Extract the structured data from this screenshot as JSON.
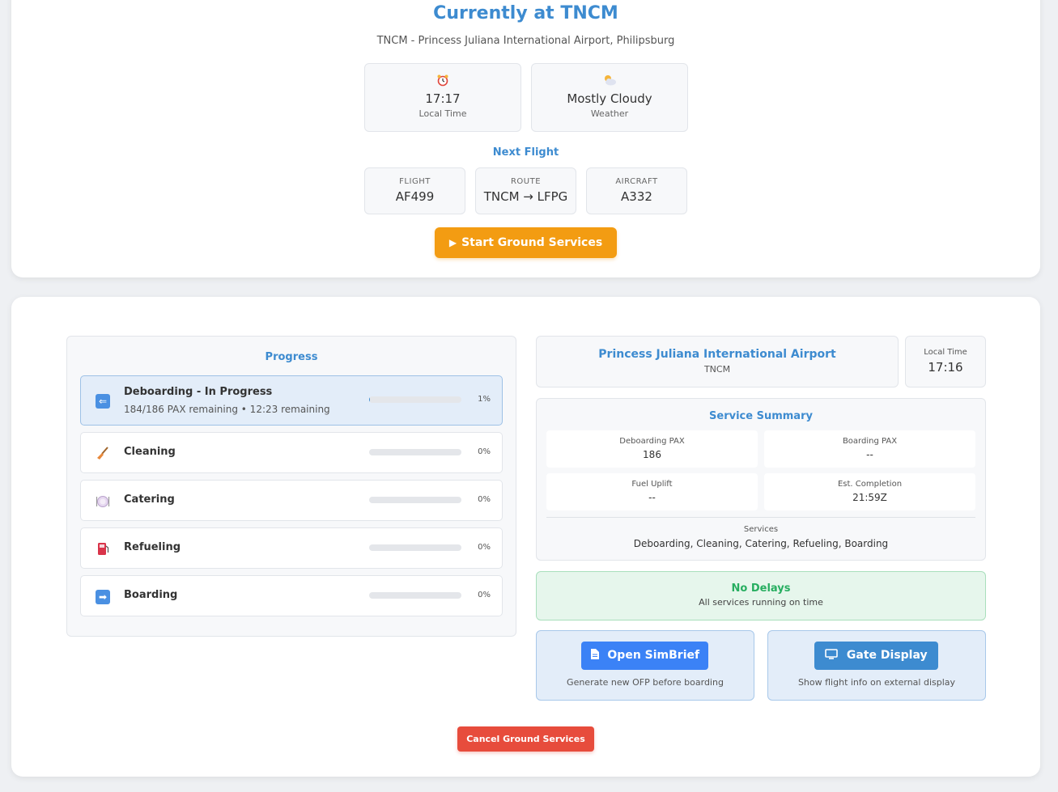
{
  "header": {
    "title": "Currently at TNCM",
    "airport_line": "TNCM - Princess Juliana International Airport, Philipsburg",
    "local_time": {
      "icon": "alarm-clock-icon",
      "value": "17:17",
      "label": "Local Time"
    },
    "weather": {
      "icon": "cloud-sun-icon",
      "value": "Mostly Cloudy",
      "label": "Weather"
    }
  },
  "next_flight": {
    "title": "Next Flight",
    "flight": {
      "label": "FLIGHT",
      "value": "AF499"
    },
    "route": {
      "label": "ROUTE",
      "value": "TNCM → LFPG"
    },
    "aircraft": {
      "label": "AIRCRAFT",
      "value": "A332"
    },
    "start_button": "Start Ground Services"
  },
  "progress": {
    "title": "Progress",
    "items": [
      {
        "name": "Deboarding - In Progress",
        "detail": "184/186 PAX remaining • 12:23 remaining",
        "progress": 0.01,
        "percent": "1%",
        "icon": "arrow-left-icon",
        "active": true
      },
      {
        "name": "Cleaning",
        "progress": 0,
        "percent": "0%",
        "icon": "broom-icon"
      },
      {
        "name": "Catering",
        "progress": 0,
        "percent": "0%",
        "icon": "plate-icon"
      },
      {
        "name": "Refueling",
        "progress": 0,
        "percent": "0%",
        "icon": "fuel-pump-icon"
      },
      {
        "name": "Boarding",
        "progress": 0,
        "percent": "0%",
        "icon": "arrow-right-icon"
      }
    ]
  },
  "airport_panel": {
    "name": "Princess Juliana International Airport",
    "code": "TNCM",
    "time_label": "Local Time",
    "time_value": "17:16"
  },
  "summary": {
    "title": "Service Summary",
    "deboarding_pax": {
      "label": "Deboarding PAX",
      "value": "186"
    },
    "boarding_pax": {
      "label": "Boarding PAX",
      "value": "--"
    },
    "fuel_uplift": {
      "label": "Fuel Uplift",
      "value": "--"
    },
    "est_completion": {
      "label": "Est. Completion",
      "value": "21:59Z"
    },
    "services_label": "Services",
    "services_value": "Deboarding, Cleaning, Catering, Refueling, Boarding"
  },
  "delays": {
    "title": "No Delays",
    "subtitle": "All services running on time",
    "color": "#27ae60"
  },
  "actions": {
    "simbrief": {
      "label": "Open SimBrief",
      "desc": "Generate new OFP before boarding",
      "icon": "document-icon",
      "color": "#3b82f6"
    },
    "gate": {
      "label": "Gate Display",
      "desc": "Show flight info on external display",
      "icon": "monitor-icon",
      "color": "#3d8bd0"
    }
  },
  "cancel_button": "Cancel Ground Services",
  "colors": {
    "accent": "#3d8bd0",
    "start": "#f39c12",
    "cancel": "#e74c3c"
  }
}
